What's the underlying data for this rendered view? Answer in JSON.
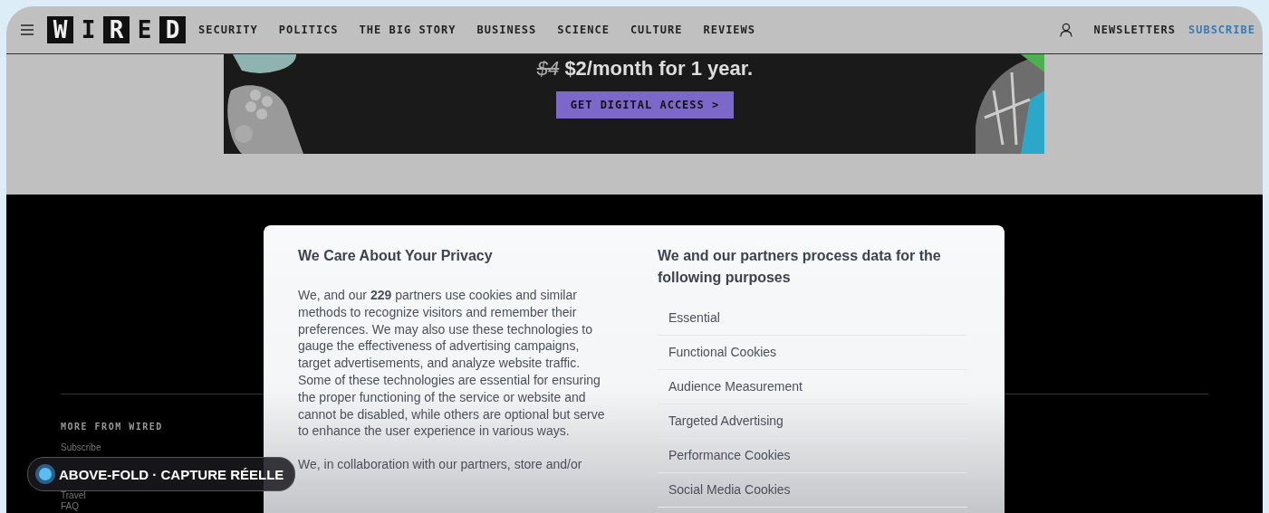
{
  "header": {
    "logo_letters": [
      {
        "char": "W",
        "inverted": true
      },
      {
        "char": "I",
        "inverted": false
      },
      {
        "char": "R",
        "inverted": true
      },
      {
        "char": "E",
        "inverted": false
      },
      {
        "char": "D",
        "inverted": true
      }
    ],
    "nav": [
      "SECURITY",
      "POLITICS",
      "THE BIG STORY",
      "BUSINESS",
      "SCIENCE",
      "CULTURE",
      "REVIEWS"
    ],
    "newsletters": "NEWSLETTERS",
    "subscribe": "SUBSCRIBE"
  },
  "promo": {
    "old_price": "$4",
    "price": "$2/month for 1 year.",
    "button": "GET DIGITAL ACCESS >"
  },
  "footer": {
    "heading": "MORE FROM WIRED",
    "links": [
      "Subscribe",
      "Travel",
      "FAQ"
    ]
  },
  "consent": {
    "title": "We Care About Your Privacy",
    "paragraphs": [
      "We, and our **229** partners use cookies and similar methods to recognize visitors and remember their preferences. We may also use these technologies to gauge the effectiveness of advertising campaigns, target advertisements, and analyze website traffic. Some of these technologies are essential for ensuring the proper functioning of the service or website and cannot be disabled, while others are optional but serve to enhance the user experience in various ways.",
      "We, in collaboration with our partners, store and/or"
    ],
    "purposes_title": "We and our partners process data for the following purposes",
    "purposes": [
      "Essential",
      "Functional Cookies",
      "Audience Measurement",
      "Targeted Advertising",
      "Performance Cookies",
      "Social Media Cookies"
    ]
  },
  "badge": {
    "text": "ABOVE-FOLD · CAPTURE RÉELLE"
  }
}
